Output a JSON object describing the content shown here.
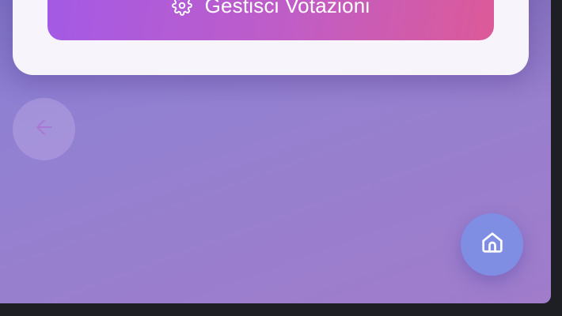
{
  "manage_button": {
    "label": "Gestisci Votazioni",
    "icon": "gear-icon"
  },
  "back_button": {
    "icon": "arrow-left-icon"
  },
  "home_button": {
    "icon": "home-icon"
  },
  "colors": {
    "background_start": "#8a7fd6",
    "background_end": "#a07ccb",
    "card": "#f8f4fb",
    "button_gradient_start": "#a35ae6",
    "button_gradient_end": "#dc5a98",
    "home_button": "#7f8ee3",
    "back_arrow": "#a978d2"
  }
}
